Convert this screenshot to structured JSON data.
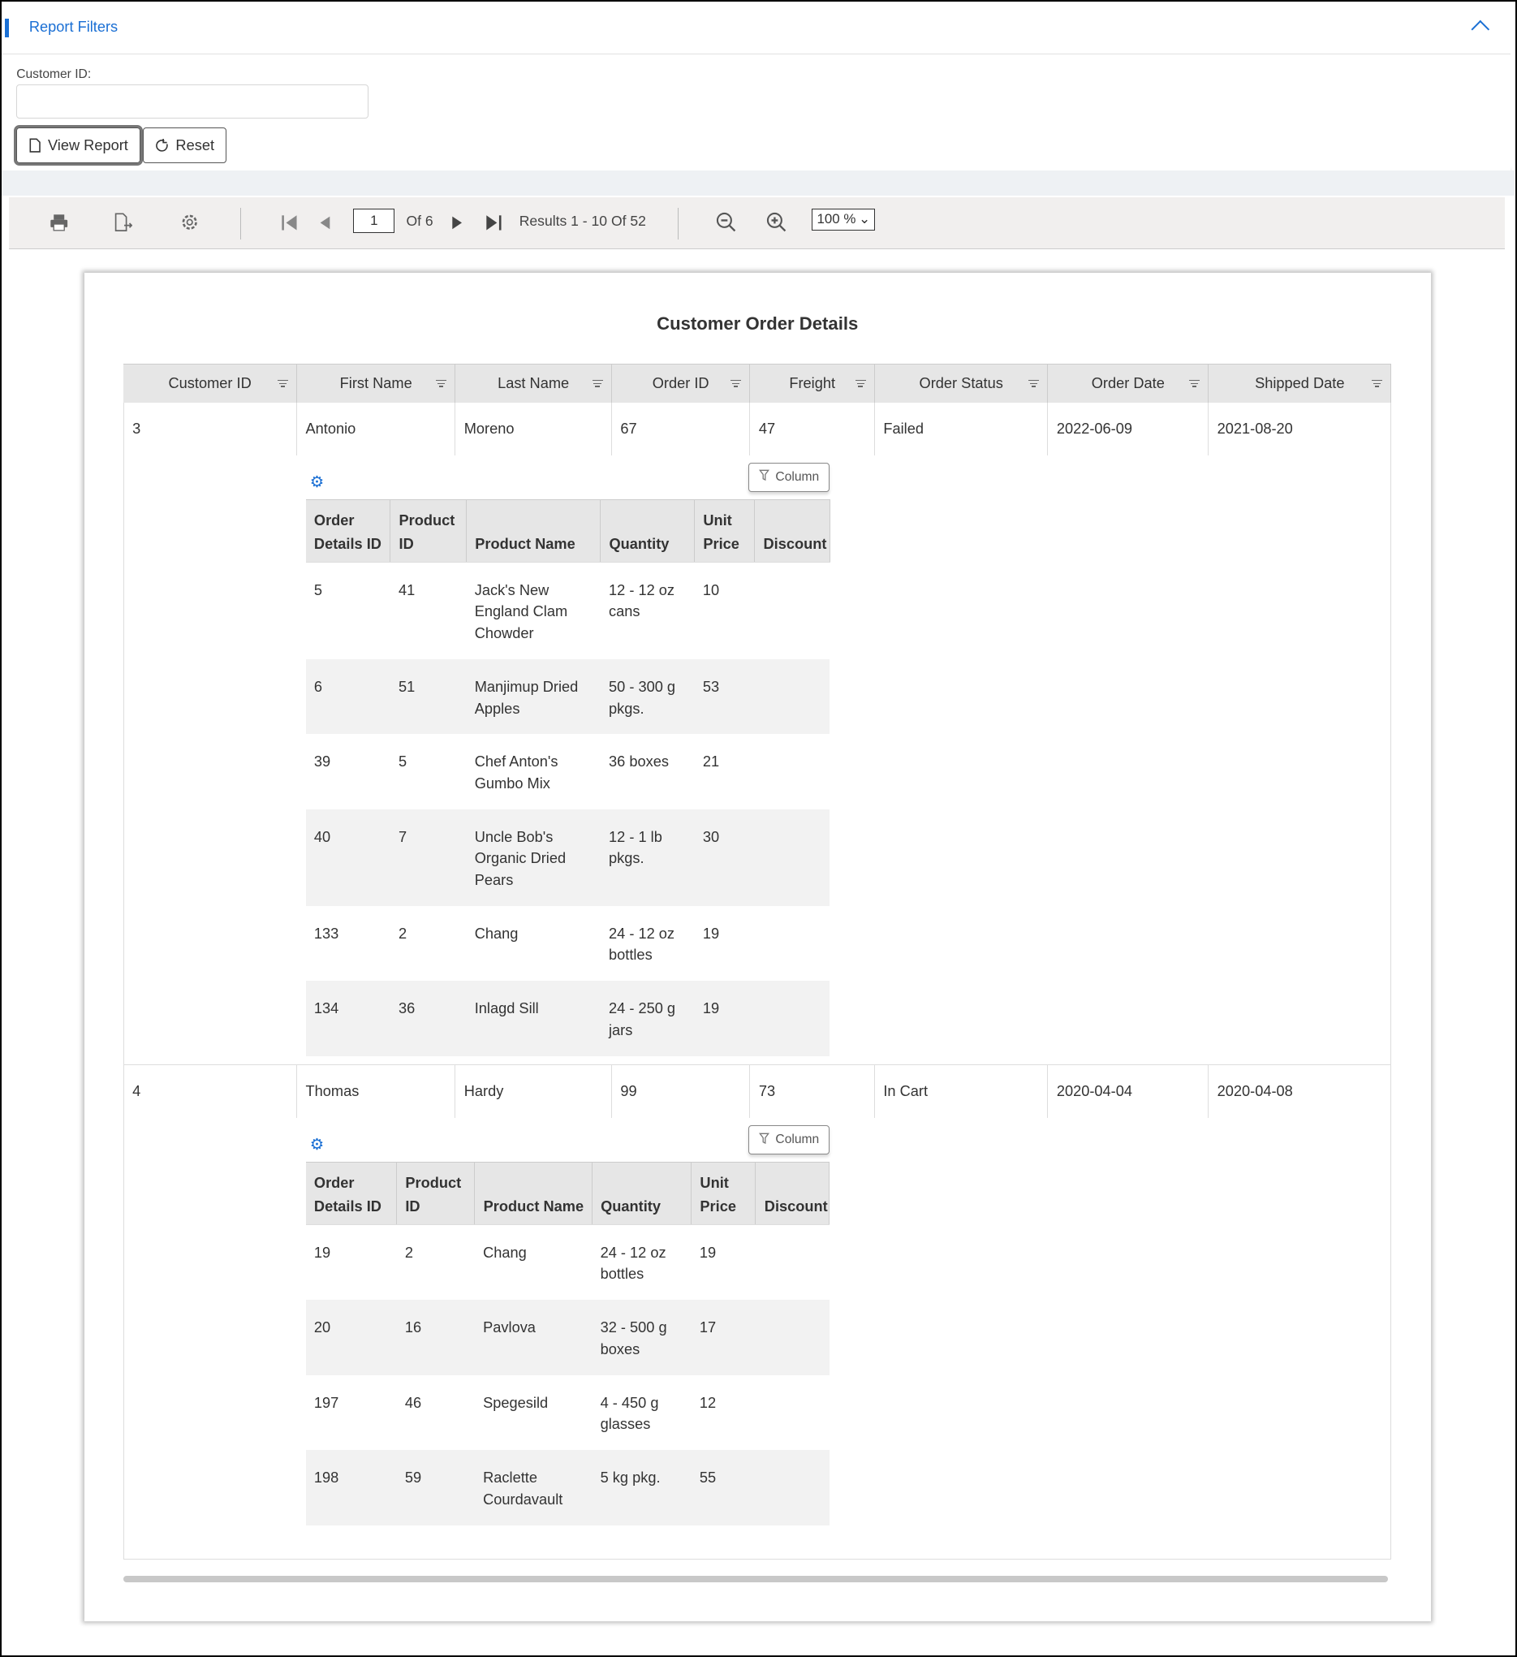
{
  "filters": {
    "title": "Report Filters",
    "customer_id_label": "Customer ID:",
    "customer_id_value": "",
    "view_report": "View Report",
    "reset": "Reset"
  },
  "toolbar": {
    "page": "1",
    "of_pages": "Of 6",
    "results": "Results 1 - 10 Of 52",
    "zoom": "100 %"
  },
  "report": {
    "title": "Customer Order Details",
    "columns": [
      "Customer ID",
      "First Name",
      "Last Name",
      "Order ID",
      "Freight",
      "Order Status",
      "Order Date",
      "Shipped Date"
    ],
    "column_button": "Column",
    "orders": [
      {
        "cells": [
          "3",
          "Antonio",
          "Moreno",
          "67",
          "47",
          "Failed",
          "2022-06-09",
          "2021-08-20"
        ],
        "detail_columns": [
          "Order Details ID",
          "Product ID",
          "Product Name",
          "Quantity",
          "Unit Price",
          "Discount"
        ],
        "details": [
          [
            "5",
            "41",
            "Jack's New England Clam Chowder",
            "12 - 12 oz cans",
            "10",
            ""
          ],
          [
            "6",
            "51",
            "Manjimup Dried Apples",
            "50 - 300 g pkgs.",
            "53",
            ""
          ],
          [
            "39",
            "5",
            "Chef Anton's Gumbo Mix",
            "36 boxes",
            "21",
            ""
          ],
          [
            "40",
            "7",
            "Uncle Bob's Organic Dried Pears",
            "12 - 1 lb pkgs.",
            "30",
            ""
          ],
          [
            "133",
            "2",
            "Chang",
            "24 - 12 oz bottles",
            "19",
            ""
          ],
          [
            "134",
            "36",
            "Inlagd Sill",
            "24 - 250 g jars",
            "19",
            ""
          ]
        ]
      },
      {
        "cells": [
          "4",
          "Thomas",
          "Hardy",
          "99",
          "73",
          "In Cart",
          "2020-04-04",
          "2020-04-08"
        ],
        "detail_columns": [
          "Order Details ID",
          "Product ID",
          "Product Name",
          "Quantity",
          "Unit Price",
          "Discount"
        ],
        "details": [
          [
            "19",
            "2",
            "Chang",
            "24 - 12 oz bottles",
            "19",
            ""
          ],
          [
            "20",
            "16",
            "Pavlova",
            "32 - 500 g boxes",
            "17",
            ""
          ],
          [
            "197",
            "46",
            "Spegesild",
            "4 - 450 g glasses",
            "12",
            ""
          ],
          [
            "198",
            "59",
            "Raclette Courdavault",
            "5 kg pkg.",
            "55",
            ""
          ]
        ]
      }
    ]
  }
}
